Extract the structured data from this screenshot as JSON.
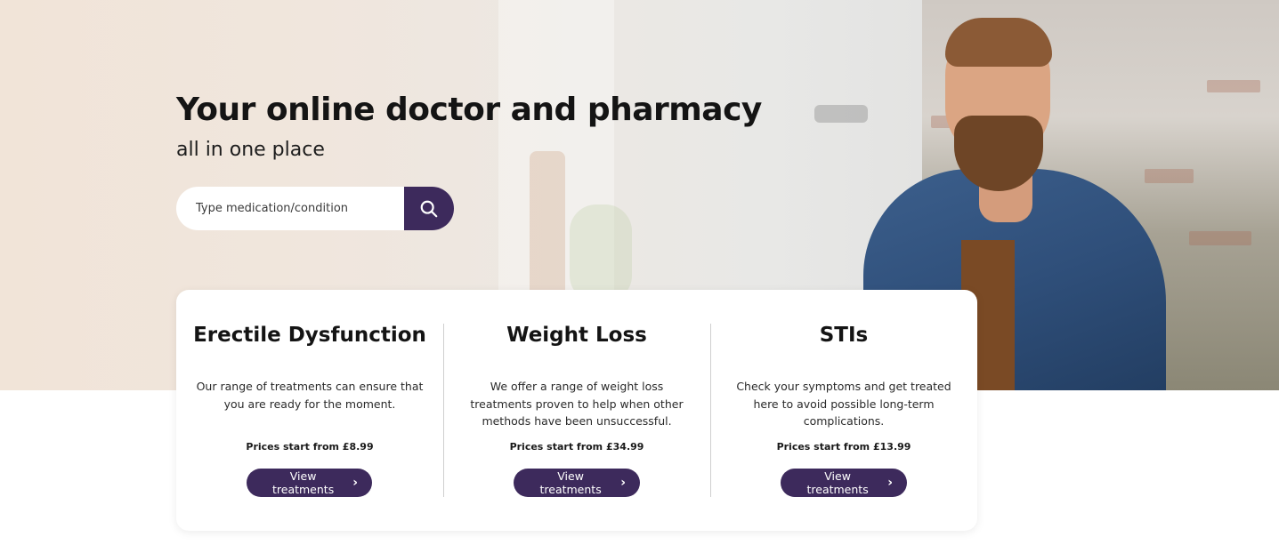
{
  "hero": {
    "title": "Your online doctor and pharmacy",
    "subtitle": "all in one place"
  },
  "search": {
    "placeholder": "Type medication/condition",
    "icon": "search-icon"
  },
  "categories": [
    {
      "title": "Erectile Dysfunction",
      "description": "Our range of treatments can ensure that you are ready for the moment.",
      "price": "Prices start from £8.99",
      "button_label": "View treatments"
    },
    {
      "title": "Weight Loss",
      "description": "We offer a range of weight loss treatments proven to help when other methods have been unsuccessful.",
      "price": "Prices start from £34.99",
      "button_label": "View treatments"
    },
    {
      "title": "STIs",
      "description": "Check your symptoms and get treated here to avoid possible long-term complications.",
      "price": "Prices start from £13.99",
      "button_label": "View treatments"
    }
  ],
  "colors": {
    "accent": "#3d2a5c",
    "text": "#141414",
    "card_bg": "#ffffff"
  }
}
